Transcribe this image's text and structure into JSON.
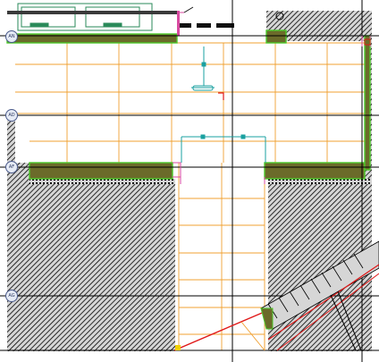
{
  "drawing": {
    "grid_labels": [
      "AN",
      "AD",
      "AF",
      "AG"
    ],
    "colors": {
      "background": "#ffffff",
      "tile_grid": "#f0a030",
      "hatch": "#000000",
      "hatch_bg": "#d6d6d6",
      "wall_fill": "#6b6b2a",
      "wall_outline": "#4cc82a",
      "axis_line": "#000000",
      "cut_line": "#e01818",
      "pink_line": "#d84aa0",
      "dimension": "#1aa0a0",
      "bubble_fill": "#e6ebf5",
      "bubble_stroke": "#4a5a8a"
    },
    "icons": [
      "grid-bubble-icon",
      "section-marker-icon"
    ]
  }
}
